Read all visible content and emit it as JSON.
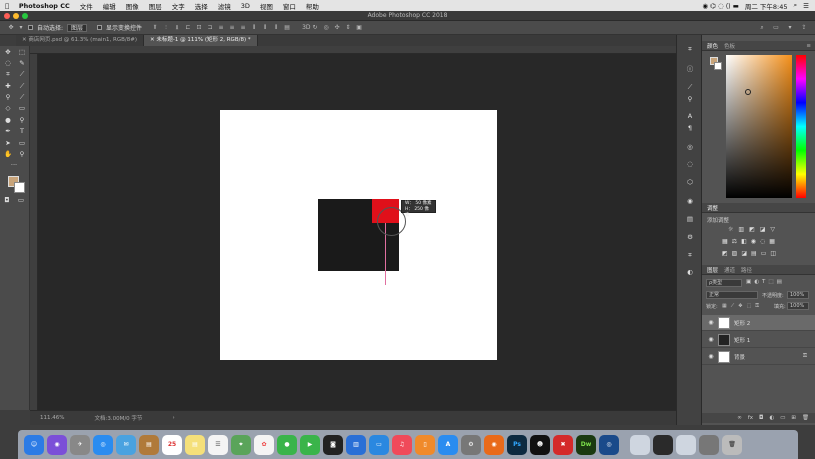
{
  "menubar": {
    "items": [
      "Photoshop CC",
      "文件",
      "编辑",
      "图像",
      "图层",
      "文字",
      "选择",
      "滤镜",
      "3D",
      "视图",
      "窗口",
      "帮助"
    ],
    "clock": "周二 下午8:45"
  },
  "window": {
    "title": "Adobe Photoshop CC 2018"
  },
  "options": {
    "auto_select_label": "自动选择:",
    "auto_select_value": "图层",
    "transform_label": "显示变换控件"
  },
  "tabs": [
    {
      "label": "商店网页.psd @ 61.3% (main1, RGB/8#)"
    },
    {
      "label": "未标题-1 @ 111% (矩形 2, RGB/8) *"
    }
  ],
  "tooltip": {
    "w": "W：  50 像素",
    "h": "H：  250 像素"
  },
  "status": {
    "zoom": "111.46%",
    "doc": "文档:3.00M/0 字节",
    "arrow": "›"
  },
  "panels": {
    "color_tabs": [
      "颜色",
      "色板"
    ],
    "adjust_title": "调整",
    "adjust_add": "添加调整",
    "layers_tabs": [
      "图层",
      "通道",
      "路径"
    ],
    "kind_label": "ρ类型",
    "blend_mode": "正常",
    "opacity_label": "不透明度:",
    "opacity_value": "100%",
    "lock_label": "锁定:",
    "fill_label": "填充:",
    "fill_value": "100%",
    "layers": [
      {
        "name": "矩形 2"
      },
      {
        "name": "矩形 1"
      },
      {
        "name": "背景"
      }
    ]
  },
  "colors": {
    "doc_bg": "#ffffff",
    "dark_rect": "#1a1a1a",
    "red_rect": "#e0101a",
    "guide": "#e070a0"
  }
}
